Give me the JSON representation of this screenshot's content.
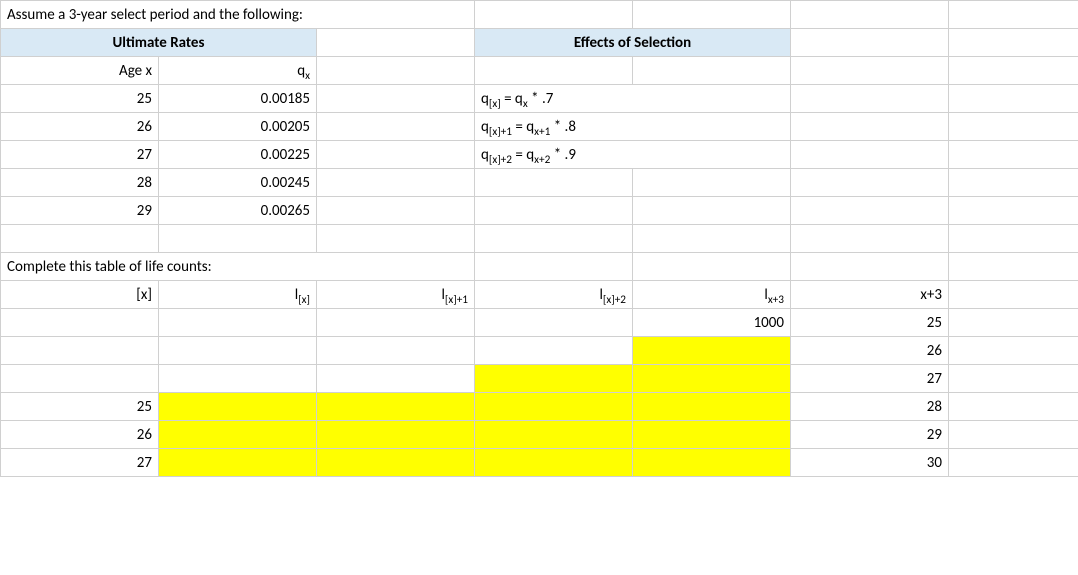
{
  "title": "Assume a 3-year select period and the following:",
  "ultimate_header": "Ultimate Rates",
  "effects_header": "Effects of Selection",
  "ultimate_col1": "Age x",
  "ultimate_col2_html": "q<sub>x</sub>",
  "ultimate_rows": [
    {
      "age": "25",
      "q": "0.00185"
    },
    {
      "age": "26",
      "q": "0.00205"
    },
    {
      "age": "27",
      "q": "0.00225"
    },
    {
      "age": "28",
      "q": "0.00245"
    },
    {
      "age": "29",
      "q": "0.00265"
    }
  ],
  "effects_rows_html": [
    "q<sub>[x]</sub> = q<sub>x</sub> * .7",
    "q<sub>[x]+1</sub> = q<sub>x+1</sub> * .8",
    "q<sub>[x]+2</sub> = q<sub>x+2</sub> * .9"
  ],
  "complete_label": "Complete this table of life counts:",
  "col_headers_html": {
    "c1": "[x]",
    "c2": "l<sub>[x]</sub>",
    "c3": "l<sub>[x]+1</sub>",
    "c4": "l<sub>[x]+2</sub>",
    "c5": "l<sub>x+3</sub>",
    "c6": "x+3"
  },
  "data_rows": [
    {
      "x": "",
      "lx5": "1000",
      "xp3": "25",
      "y2": false,
      "y3": false,
      "y4": false,
      "y5": false
    },
    {
      "x": "",
      "lx5": "",
      "xp3": "26",
      "y2": false,
      "y3": false,
      "y4": false,
      "y5": true
    },
    {
      "x": "",
      "lx5": "",
      "xp3": "27",
      "y2": false,
      "y3": false,
      "y4": true,
      "y5": true
    },
    {
      "x": "25",
      "lx5": "",
      "xp3": "28",
      "y2": true,
      "y3": true,
      "y4": true,
      "y5": true
    },
    {
      "x": "26",
      "lx5": "",
      "xp3": "29",
      "y2": true,
      "y3": true,
      "y4": true,
      "y5": true
    },
    {
      "x": "27",
      "lx5": "",
      "xp3": "30",
      "y2": true,
      "y3": true,
      "y4": true,
      "y5": true
    }
  ]
}
